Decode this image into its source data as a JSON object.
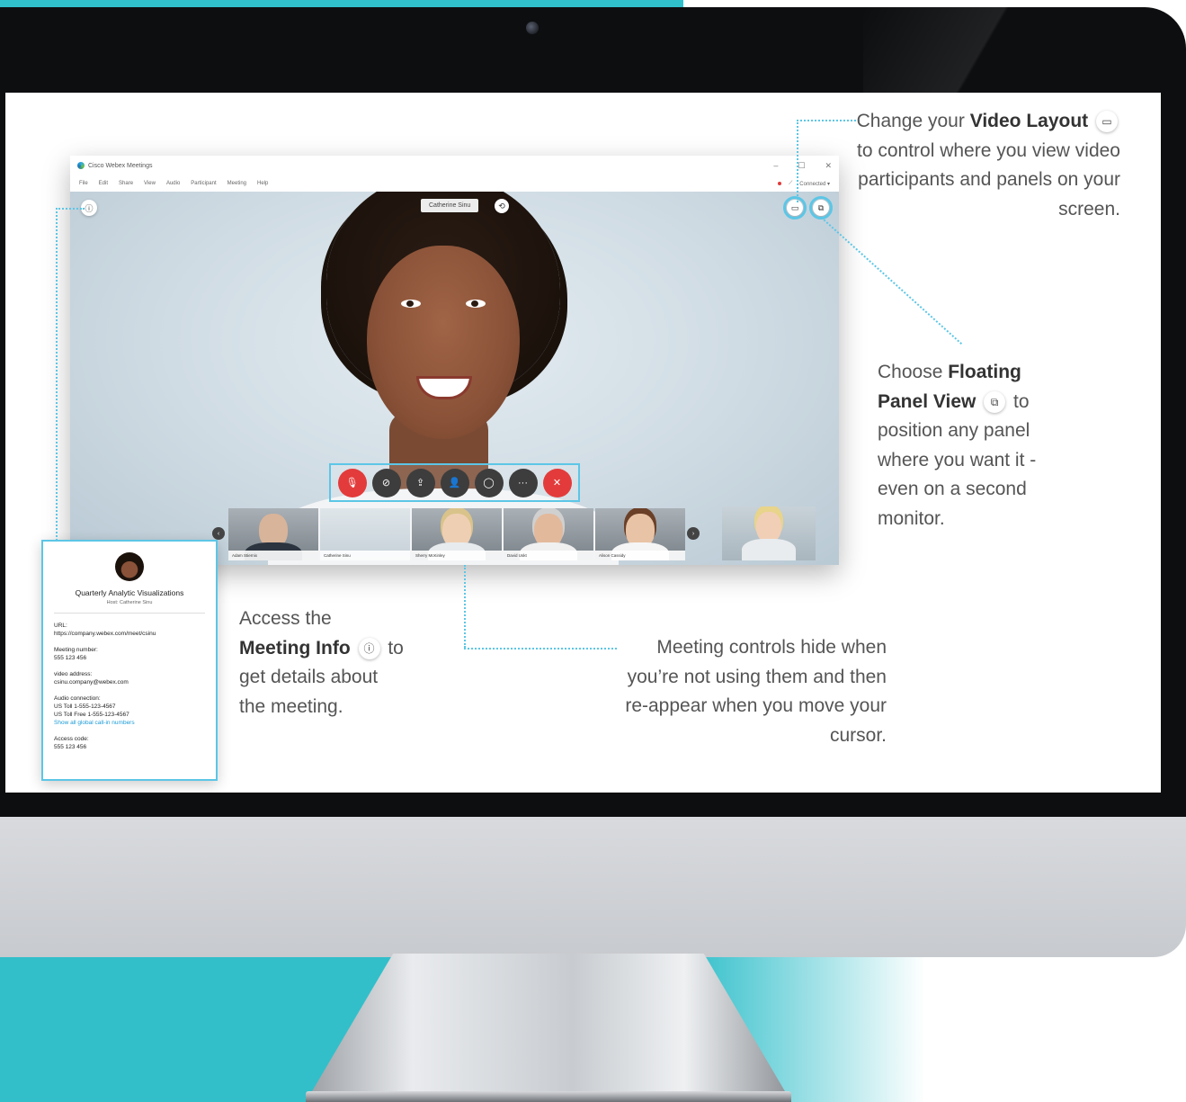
{
  "app": {
    "title": "Cisco Webex Meetings",
    "window_controls": [
      "–",
      "☐",
      "✕"
    ],
    "menu": [
      "File",
      "Edit",
      "Share",
      "View",
      "Audio",
      "Participant",
      "Meeting",
      "Help"
    ],
    "status": "Connected ▾",
    "active_speaker": "Catherine Sinu"
  },
  "controls": {
    "mute_icon": "microphone-icon",
    "video_icon": "video-off-icon",
    "share_icon": "share-icon",
    "participants_icon": "participants-icon",
    "chat_icon": "chat-icon",
    "more_icon": "more-icon",
    "leave_icon": "leave-icon",
    "more_glyph": "···",
    "leave_glyph": "✕"
  },
  "thumbnails": [
    {
      "name": "Adam Stiernix"
    },
    {
      "name": "Catherine Sinu"
    },
    {
      "name": "Sherry McKinley"
    },
    {
      "name": "David Uskt"
    },
    {
      "name": "Alison Cassidy"
    }
  ],
  "meeting_info": {
    "title": "Quarterly Analytic Visualizations",
    "host": "Host: Catherine Sinu",
    "url_label": "URL:",
    "url": "https://company.webex.com/meet/csinu",
    "number_label": "Meeting number:",
    "number": "555 123 456",
    "video_label": "video address:",
    "video_address": "csinu.company@webex.com",
    "audio_label": "Audio connection:",
    "toll": "US Toll 1-555-123-4567",
    "toll_free": "US Toll Free 1-555-123-4567",
    "global_link": "Show all global call-in numbers",
    "access_label": "Access code:",
    "access_code": "555 123 456"
  },
  "callouts": {
    "layout": {
      "pre": "Change your ",
      "bold": "Video Layout",
      "post": " to control where you view video participants and panels on your screen."
    },
    "floating": {
      "pre": "Choose ",
      "bold": "Floating Panel View",
      "post": " to position any panel where you want it - even on a second monitor."
    },
    "info": {
      "pre": "Access the ",
      "bold": "Meeting Info",
      "post": " to get details about the meeting."
    },
    "controls": {
      "text": "Meeting controls hide when you’re not using them and then re-appear when you move your cursor."
    }
  },
  "colors": {
    "accent": "#5cc6e6",
    "teal": "#32bfca",
    "leave_red": "#e33b3b"
  }
}
